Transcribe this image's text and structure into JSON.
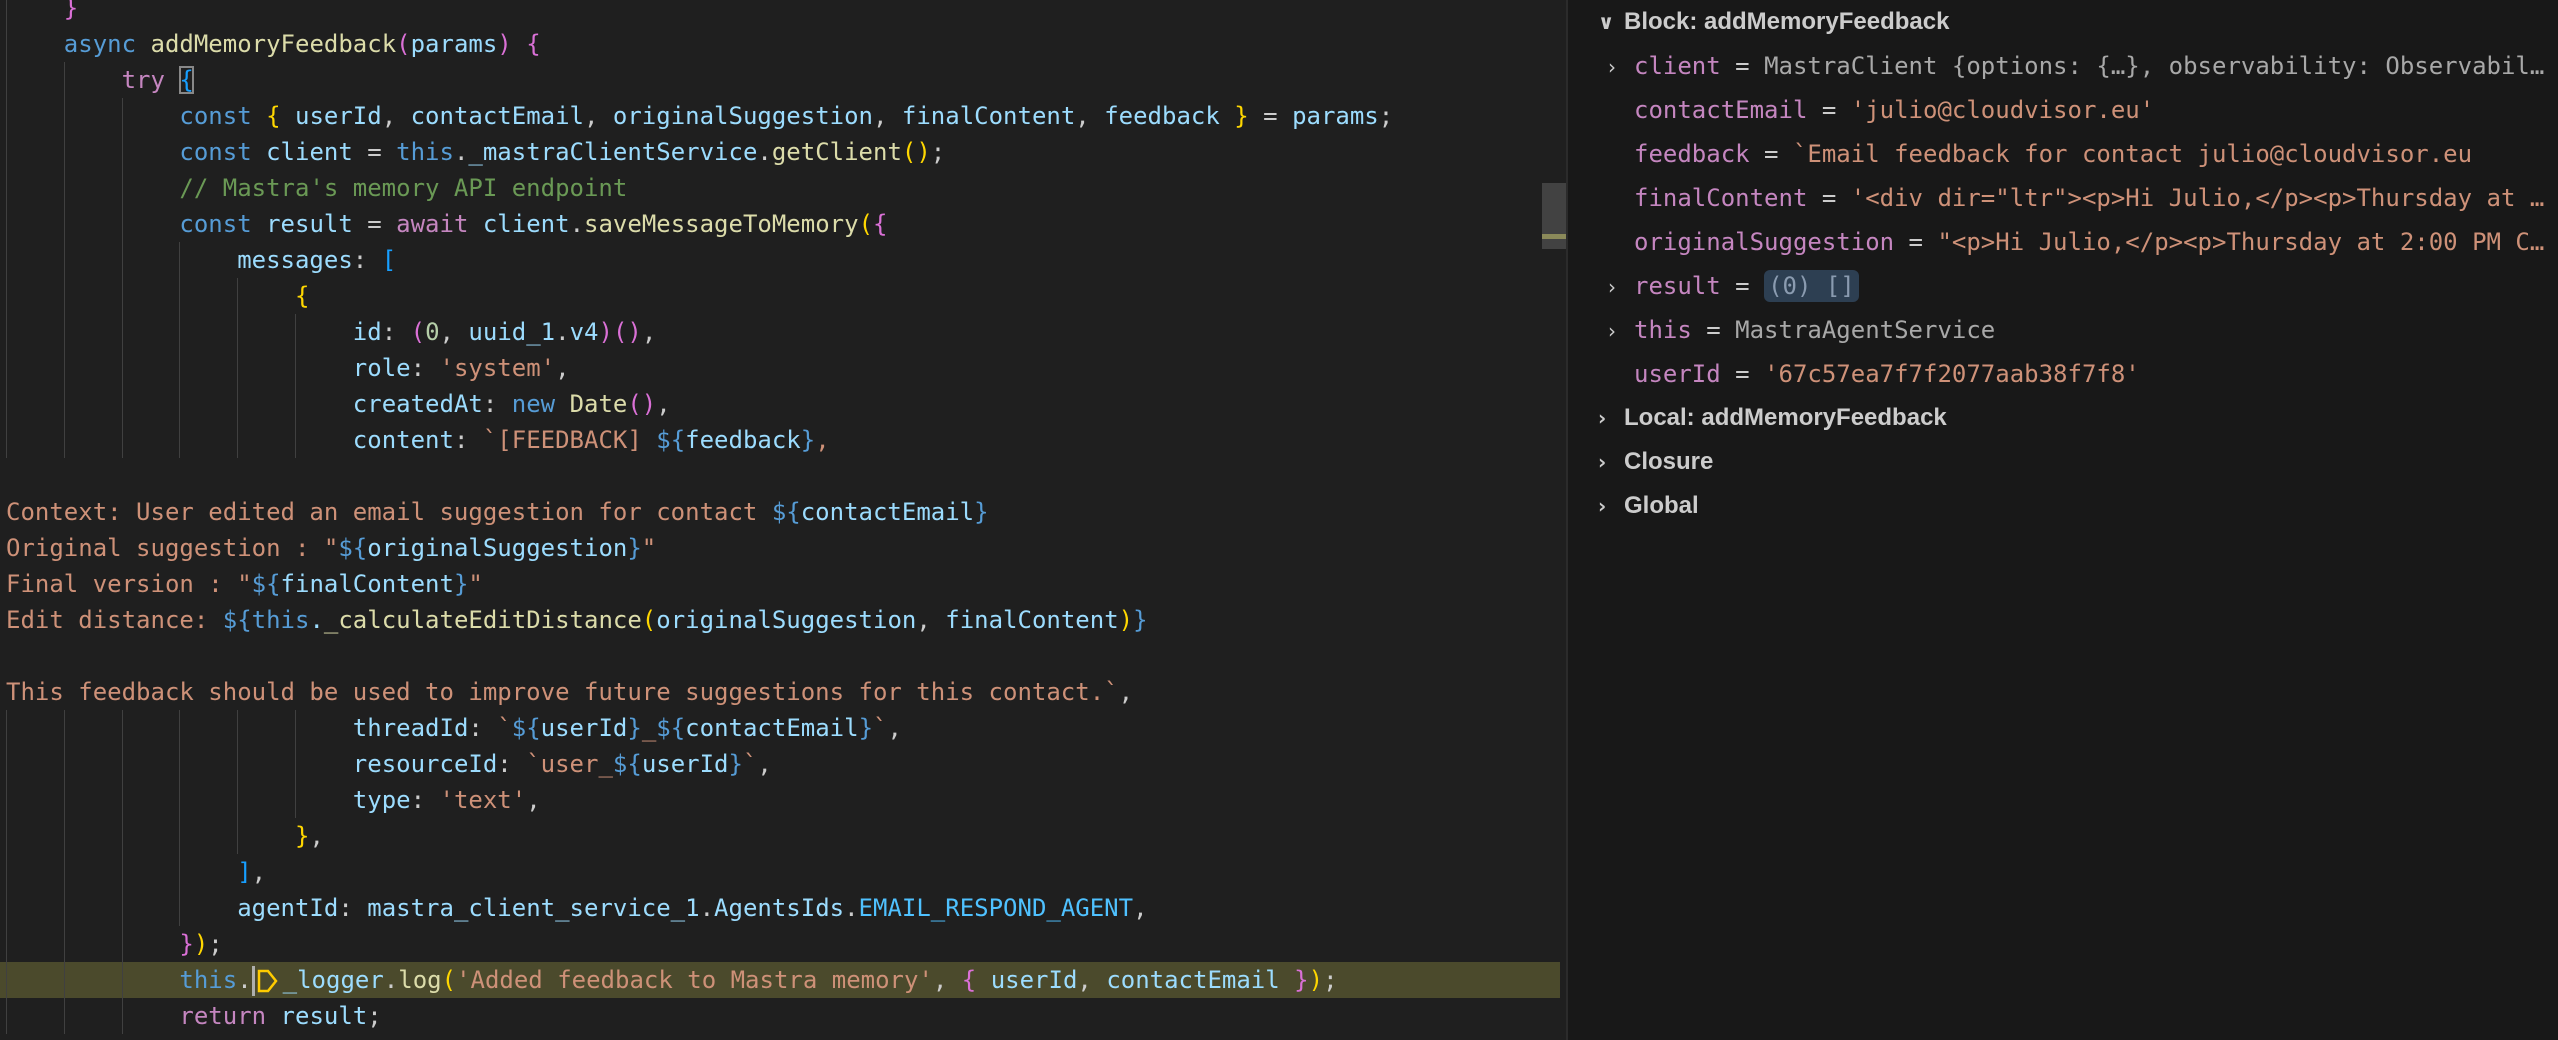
{
  "colors": {
    "keyword": "#569cd6",
    "control": "#c586c0",
    "function": "#dcdcaa",
    "variable": "#9cdcfe",
    "string": "#ce9178",
    "comment": "#6a9955",
    "highlight": "#4b4a2c"
  },
  "editor": {
    "lines": [
      {
        "indent": 4,
        "tokens": [
          [
            "}",
            "b2"
          ]
        ]
      },
      {
        "indent": 4,
        "tokens": [
          [
            "async",
            "k"
          ],
          [
            " ",
            "p"
          ],
          [
            "addMemoryFeedback",
            "f"
          ],
          [
            "(",
            "b2"
          ],
          [
            "params",
            "v"
          ],
          [
            ")",
            "b2"
          ],
          [
            " ",
            "p"
          ],
          [
            "{",
            "b2"
          ]
        ]
      },
      {
        "indent": 8,
        "tokens": [
          [
            "try",
            "c"
          ],
          [
            " ",
            "p"
          ],
          [
            "{",
            "b3 box"
          ]
        ]
      },
      {
        "indent": 12,
        "tokens": [
          [
            "const",
            "k"
          ],
          [
            " ",
            "p"
          ],
          [
            "{",
            "b1"
          ],
          [
            " ",
            "p"
          ],
          [
            "userId",
            "v"
          ],
          [
            ", ",
            "p"
          ],
          [
            "contactEmail",
            "v"
          ],
          [
            ", ",
            "p"
          ],
          [
            "originalSuggestion",
            "v"
          ],
          [
            ", ",
            "p"
          ],
          [
            "finalContent",
            "v"
          ],
          [
            ", ",
            "p"
          ],
          [
            "feedback",
            "v"
          ],
          [
            " ",
            "p"
          ],
          [
            "}",
            "b1"
          ],
          [
            " = ",
            "p"
          ],
          [
            "params",
            "v"
          ],
          [
            ";",
            "p"
          ]
        ]
      },
      {
        "indent": 12,
        "tokens": [
          [
            "const",
            "k"
          ],
          [
            " ",
            "p"
          ],
          [
            "client",
            "v"
          ],
          [
            " = ",
            "p"
          ],
          [
            "this",
            "k"
          ],
          [
            ".",
            "p"
          ],
          [
            "_mastraClientService",
            "v"
          ],
          [
            ".",
            "p"
          ],
          [
            "getClient",
            "f"
          ],
          [
            "()",
            "b1"
          ],
          [
            ";",
            "p"
          ]
        ]
      },
      {
        "indent": 12,
        "tokens": [
          [
            "// Mastra's memory API endpoint",
            "m"
          ]
        ]
      },
      {
        "indent": 12,
        "tokens": [
          [
            "const",
            "k"
          ],
          [
            " ",
            "p"
          ],
          [
            "result",
            "v"
          ],
          [
            " = ",
            "p"
          ],
          [
            "await",
            "c"
          ],
          [
            " ",
            "p"
          ],
          [
            "client",
            "v"
          ],
          [
            ".",
            "p"
          ],
          [
            "saveMessageToMemory",
            "f"
          ],
          [
            "(",
            "b1"
          ],
          [
            "{",
            "b2"
          ]
        ]
      },
      {
        "indent": 16,
        "tokens": [
          [
            "messages",
            "v"
          ],
          [
            ": ",
            "p"
          ],
          [
            "[",
            "b3"
          ]
        ]
      },
      {
        "indent": 20,
        "tokens": [
          [
            "{",
            "b1"
          ]
        ]
      },
      {
        "indent": 24,
        "tokens": [
          [
            "id",
            "v"
          ],
          [
            ": ",
            "p"
          ],
          [
            "(",
            "b2"
          ],
          [
            "0",
            "n"
          ],
          [
            ", ",
            "p"
          ],
          [
            "uuid_1",
            "v"
          ],
          [
            ".",
            "p"
          ],
          [
            "v4",
            "v"
          ],
          [
            ")",
            "b2"
          ],
          [
            "()",
            "b2"
          ],
          [
            ",",
            "p"
          ]
        ]
      },
      {
        "indent": 24,
        "tokens": [
          [
            "role",
            "v"
          ],
          [
            ": ",
            "p"
          ],
          [
            "'system'",
            "s"
          ],
          [
            ",",
            "p"
          ]
        ]
      },
      {
        "indent": 24,
        "tokens": [
          [
            "createdAt",
            "v"
          ],
          [
            ": ",
            "p"
          ],
          [
            "new",
            "k"
          ],
          [
            " ",
            "p"
          ],
          [
            "Date",
            "f"
          ],
          [
            "()",
            "b2"
          ],
          [
            ",",
            "p"
          ]
        ]
      },
      {
        "indent": 24,
        "tokens": [
          [
            "content",
            "v"
          ],
          [
            ": ",
            "p"
          ],
          [
            "`[FEEDBACK] ",
            "s"
          ],
          [
            "${",
            "t"
          ],
          [
            "feedback",
            "v"
          ],
          [
            "}",
            "t"
          ],
          [
            ",",
            "s"
          ]
        ]
      },
      {
        "indent": 0,
        "tokens": []
      },
      {
        "indent": 0,
        "tokens": [
          [
            "Context: User edited an email suggestion for contact ",
            "s"
          ],
          [
            "${",
            "t"
          ],
          [
            "contactEmail",
            "v"
          ],
          [
            "}",
            "t"
          ]
        ]
      },
      {
        "indent": 0,
        "tokens": [
          [
            "Original suggestion : \"",
            "s"
          ],
          [
            "${",
            "t"
          ],
          [
            "originalSuggestion",
            "v"
          ],
          [
            "}",
            "t"
          ],
          [
            "\"",
            "s"
          ]
        ]
      },
      {
        "indent": 0,
        "tokens": [
          [
            "Final version : \"",
            "s"
          ],
          [
            "${",
            "t"
          ],
          [
            "finalContent",
            "v"
          ],
          [
            "}",
            "t"
          ],
          [
            "\"",
            "s"
          ]
        ]
      },
      {
        "indent": 0,
        "tokens": [
          [
            "Edit distance: ",
            "s"
          ],
          [
            "${",
            "t"
          ],
          [
            "this",
            "k"
          ],
          [
            ".",
            "v"
          ],
          [
            "_calculateEditDistance",
            "f"
          ],
          [
            "(",
            "b1"
          ],
          [
            "originalSuggestion",
            "v"
          ],
          [
            ", ",
            "p"
          ],
          [
            "finalContent",
            "v"
          ],
          [
            ")",
            "b1"
          ],
          [
            "}",
            "t"
          ]
        ]
      },
      {
        "indent": 0,
        "tokens": []
      },
      {
        "indent": 0,
        "tokens": [
          [
            "This feedback should be used to improve future suggestions for this contact.`",
            "s"
          ],
          [
            ",",
            "p"
          ]
        ]
      },
      {
        "indent": 24,
        "tokens": [
          [
            "threadId",
            "v"
          ],
          [
            ": ",
            "p"
          ],
          [
            "`",
            "s"
          ],
          [
            "${",
            "t"
          ],
          [
            "userId",
            "v"
          ],
          [
            "}",
            "t"
          ],
          [
            "_",
            "s"
          ],
          [
            "${",
            "t"
          ],
          [
            "contactEmail",
            "v"
          ],
          [
            "}",
            "t"
          ],
          [
            "`",
            "s"
          ],
          [
            ",",
            "p"
          ]
        ]
      },
      {
        "indent": 24,
        "tokens": [
          [
            "resourceId",
            "v"
          ],
          [
            ": ",
            "p"
          ],
          [
            "`user_",
            "s"
          ],
          [
            "${",
            "t"
          ],
          [
            "userId",
            "v"
          ],
          [
            "}",
            "t"
          ],
          [
            "`",
            "s"
          ],
          [
            ",",
            "p"
          ]
        ]
      },
      {
        "indent": 24,
        "tokens": [
          [
            "type",
            "v"
          ],
          [
            ": ",
            "p"
          ],
          [
            "'text'",
            "s"
          ],
          [
            ",",
            "p"
          ]
        ]
      },
      {
        "indent": 20,
        "tokens": [
          [
            "}",
            "b1"
          ],
          [
            ",",
            "p"
          ]
        ]
      },
      {
        "indent": 16,
        "tokens": [
          [
            "]",
            "b3"
          ],
          [
            ",",
            "p"
          ]
        ]
      },
      {
        "indent": 16,
        "tokens": [
          [
            "agentId",
            "v"
          ],
          [
            ": ",
            "p"
          ],
          [
            "mastra_client_service_1",
            "v"
          ],
          [
            ".",
            "p"
          ],
          [
            "AgentsIds",
            "v"
          ],
          [
            ".",
            "p"
          ],
          [
            "EMAIL_RESPOND_AGENT",
            "cn"
          ],
          [
            ",",
            "p"
          ]
        ]
      },
      {
        "indent": 12,
        "tokens": [
          [
            "}",
            "b2"
          ],
          [
            ")",
            "b1"
          ],
          [
            ";",
            "p"
          ]
        ]
      },
      {
        "indent": 12,
        "highlight": true,
        "tokens": [
          [
            "this",
            "k"
          ],
          [
            ".",
            "p"
          ],
          [
            "",
            "cursor"
          ],
          [
            "",
            "bp"
          ],
          [
            "_logger",
            "v"
          ],
          [
            ".",
            "p"
          ],
          [
            "log",
            "f"
          ],
          [
            "(",
            "b1"
          ],
          [
            "'Added feedback to Mastra memory'",
            "s"
          ],
          [
            ", ",
            "p"
          ],
          [
            "{",
            "b2"
          ],
          [
            " ",
            "p"
          ],
          [
            "userId",
            "v"
          ],
          [
            ", ",
            "p"
          ],
          [
            "contactEmail",
            "v"
          ],
          [
            " ",
            "p"
          ],
          [
            "}",
            "b2"
          ],
          [
            ")",
            "b1"
          ],
          [
            ";",
            "p"
          ]
        ]
      },
      {
        "indent": 12,
        "tokens": [
          [
            "return",
            "c"
          ],
          [
            " ",
            "p"
          ],
          [
            "result",
            "v"
          ],
          [
            ";",
            "p"
          ]
        ]
      }
    ]
  },
  "variables": {
    "block_scope": "Block: addMemoryFeedback",
    "items": [
      {
        "name": "client",
        "eq": " = ",
        "value": "MastraClient {options: {…}, observability: Observabil…",
        "kind": "vobj",
        "expandable": true
      },
      {
        "name": "contactEmail",
        "eq": " = ",
        "value": "'julio@cloudvisor.eu'",
        "kind": "vstr",
        "expandable": false
      },
      {
        "name": "feedback",
        "eq": " = ",
        "value": "`Email feedback for contact julio@cloudvisor.eu",
        "kind": "vstr",
        "expandable": false
      },
      {
        "name": "finalContent",
        "eq": " = ",
        "value": "'<div dir=\"ltr\"><p>Hi Julio,</p><p>Thursday at …",
        "kind": "vstr",
        "expandable": false
      },
      {
        "name": "originalSuggestion",
        "eq": " = ",
        "value": "\"<p>Hi Julio,</p><p>Thursday at 2:00 PM C…",
        "kind": "vstr",
        "expandable": false
      },
      {
        "name": "result",
        "eq": " = ",
        "value": "(0) []",
        "kind": "badge",
        "expandable": true
      },
      {
        "name": "this",
        "eq": " = ",
        "value": "MastraAgentService",
        "kind": "vobj",
        "expandable": true
      },
      {
        "name": "userId",
        "eq": " = ",
        "value": "'67c57ea7f7f2077aab38f7f8'",
        "kind": "vstr",
        "expandable": false
      }
    ],
    "other_scopes": [
      "Local: addMemoryFeedback",
      "Closure",
      "Global"
    ],
    "chevron_open": "∨",
    "chevron_closed": "›"
  }
}
